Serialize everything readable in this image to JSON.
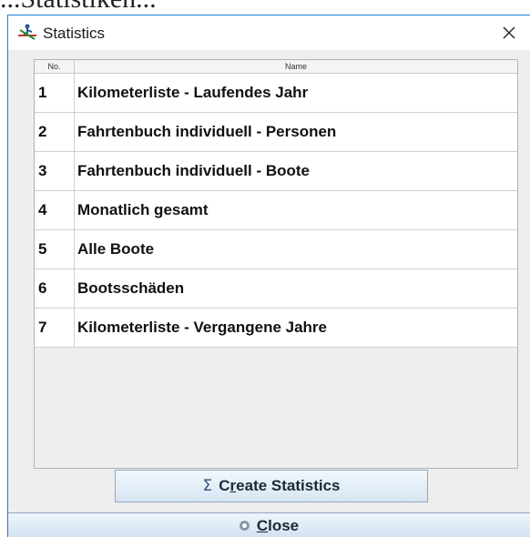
{
  "background": {
    "partial_text": "...Statistiken..."
  },
  "window": {
    "title": "Statistics",
    "icon": "rower-icon",
    "close_glyph": "✕"
  },
  "table": {
    "columns": [
      "No.",
      "Name"
    ],
    "rows": [
      {
        "no": "1",
        "name": "Kilometerliste - Laufendes Jahr"
      },
      {
        "no": "2",
        "name": "Fahrtenbuch individuell - Personen"
      },
      {
        "no": "3",
        "name": "Fahrtenbuch individuell - Boote"
      },
      {
        "no": "4",
        "name": "Monatlich gesamt"
      },
      {
        "no": "5",
        "name": "Alle Boote"
      },
      {
        "no": "6",
        "name": "Bootsschäden"
      },
      {
        "no": "7",
        "name": "Kilometerliste - Vergangene Jahre"
      }
    ]
  },
  "buttons": {
    "create": {
      "icon": "Σ",
      "prefix": "C",
      "mnemonic": "r",
      "suffix": "eate Statistics"
    },
    "close": {
      "mnemonic": "C",
      "suffix": "lose"
    }
  },
  "colors": {
    "title_border": "#1b7dd6",
    "button_top": "#f1f7fc",
    "button_bottom": "#d7e6f3",
    "content_bg": "#eeeeee"
  }
}
